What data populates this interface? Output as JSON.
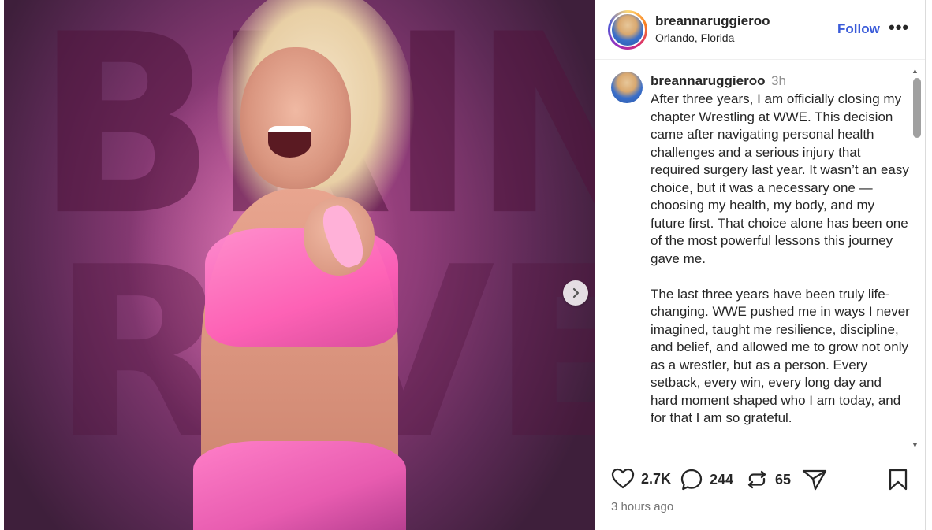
{
  "media": {
    "background_text": "BRINLEY",
    "background_text2": "RIVERA"
  },
  "header": {
    "username": "breannaruggieroo",
    "location": "Orlando, Florida",
    "follow_label": "Follow",
    "more_label": "•••"
  },
  "caption": {
    "username": "breannaruggieroo",
    "time": "3h",
    "text": "After three years, I am officially closing my chapter Wrestling at WWE. This decision came after navigating personal health challenges and a serious injury that required surgery last year. It wasn’t an easy choice, but it was a necessary one — choosing my health, my body, and my future first. That choice alone has been one of the most powerful lessons this journey gave me.\n\nThe last three years have been truly life-changing. WWE pushed me in ways I never imagined, taught me resilience, discipline, and belief, and allowed me to grow not only as a wrestler, but as a person. Every setback, every win, every long day and hard moment shaped who I am today, and for that I am so grateful."
  },
  "actions": {
    "likes": "2.7K",
    "comments": "244",
    "reposts": "65",
    "time_ago": "3 hours ago"
  },
  "colors": {
    "accent": "#3a5bd9",
    "muted": "#8e8e8e"
  },
  "icons": [
    "chevron-right-icon",
    "heart-icon",
    "comment-icon",
    "repost-icon",
    "share-icon",
    "bookmark-icon",
    "more-icon"
  ]
}
